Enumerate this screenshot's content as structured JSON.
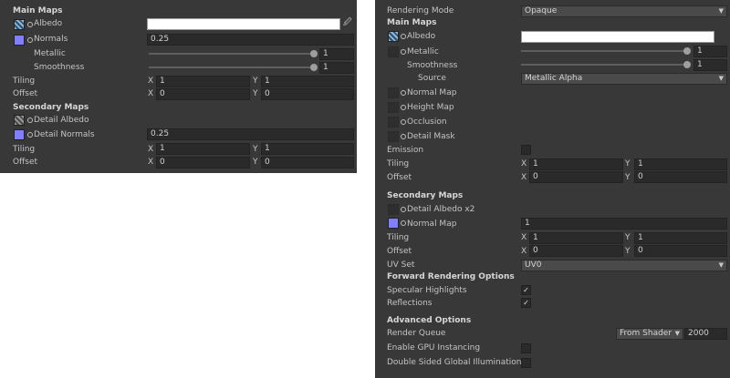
{
  "left": {
    "main_maps": "Main Maps",
    "albedo": "Albedo",
    "normals": "Normals",
    "normals_value": "0.25",
    "metallic": "Metallic",
    "metallic_value": "1",
    "smoothness": "Smoothness",
    "smoothness_value": "1",
    "tiling": "Tiling",
    "offset": "Offset",
    "x": "X",
    "y": "Y",
    "tiling_x": "1",
    "tiling_y": "1",
    "offset_x": "0",
    "offset_y": "0",
    "secondary_maps": "Secondary Maps",
    "detail_albedo": "Detail Albedo",
    "detail_normals": "Detail Normals",
    "detail_normals_value": "0.25",
    "sec_tiling_x": "1",
    "sec_tiling_y": "1",
    "sec_offset_x": "0",
    "sec_offset_y": "0"
  },
  "right": {
    "rendering_mode": "Rendering Mode",
    "rendering_mode_value": "Opaque",
    "main_maps": "Main Maps",
    "albedo": "Albedo",
    "metallic": "Metallic",
    "metallic_value": "1",
    "smoothness": "Smoothness",
    "smoothness_value": "1",
    "source": "Source",
    "source_value": "Metallic Alpha",
    "normal_map": "Normal Map",
    "height_map": "Height Map",
    "occlusion": "Occlusion",
    "detail_mask": "Detail Mask",
    "emission": "Emission",
    "tiling": "Tiling",
    "offset": "Offset",
    "x": "X",
    "y": "Y",
    "tiling_x": "1",
    "tiling_y": "1",
    "offset_x": "0",
    "offset_y": "0",
    "secondary_maps": "Secondary Maps",
    "detail_albedo": "Detail Albedo x2",
    "normal_map2": "Normal Map",
    "normal_map2_value": "1",
    "sec_tiling_x": "1",
    "sec_tiling_y": "1",
    "sec_offset_x": "0",
    "sec_offset_y": "0",
    "uv_set": "UV Set",
    "uv_set_value": "UV0",
    "forward_options": "Forward Rendering Options",
    "specular": "Specular Highlights",
    "reflections": "Reflections",
    "advanced": "Advanced Options",
    "render_queue": "Render Queue",
    "render_queue_mode": "From Shader",
    "render_queue_value": "2000",
    "gpu_instancing": "Enable GPU Instancing",
    "double_sided_gi": "Double Sided Global Illumination"
  },
  "icons": {
    "checkmark": "✓",
    "arrow": "▼",
    "picker": "🖉"
  }
}
